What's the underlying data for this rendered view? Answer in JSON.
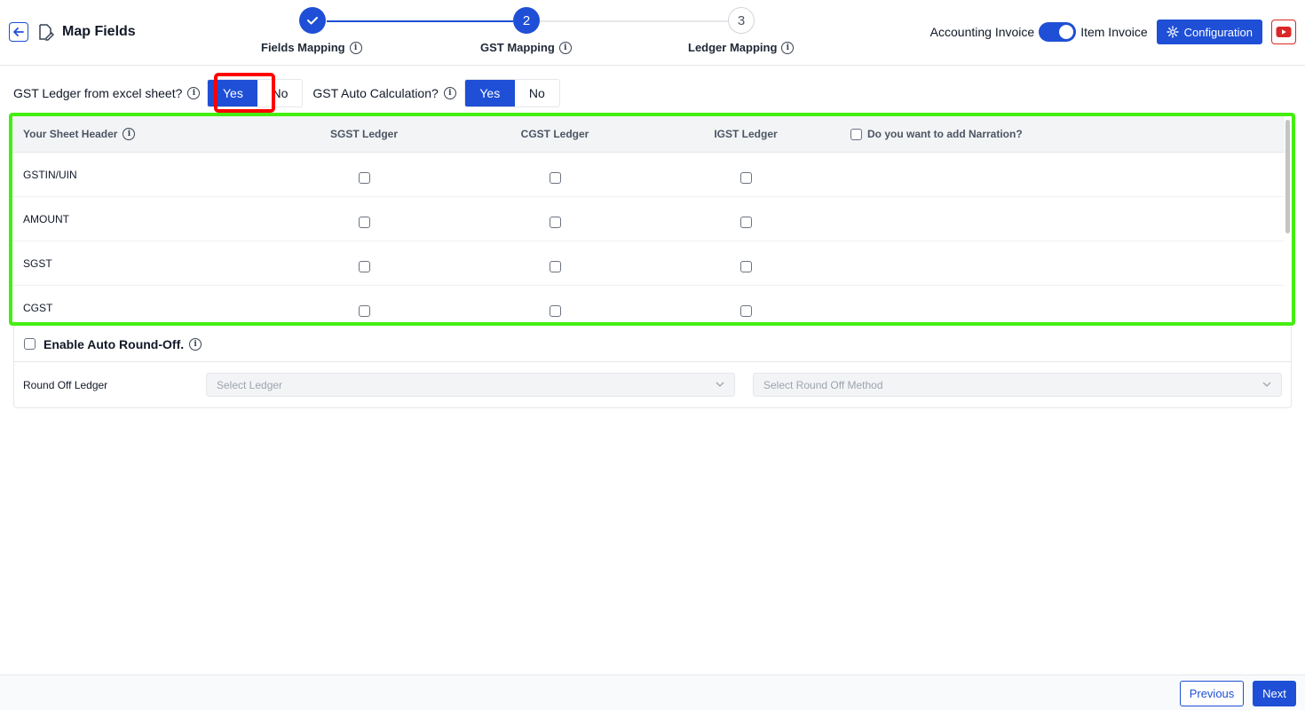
{
  "header": {
    "title": "Map Fields",
    "steps": [
      {
        "number": "",
        "label": "Fields Mapping",
        "state": "done"
      },
      {
        "number": "2",
        "label": "GST Mapping",
        "state": "active"
      },
      {
        "number": "3",
        "label": "Ledger Mapping",
        "state": "pending"
      }
    ],
    "accounting_label": "Accounting Invoice",
    "item_label": "Item Invoice",
    "config_label": "Configuration",
    "icons": [
      "back-arrow-icon",
      "edit-document-icon",
      "check-icon",
      "info-icon",
      "gear-icon",
      "youtube-icon"
    ]
  },
  "questions": {
    "gst_ledger_label": "GST Ledger from excel sheet?",
    "gst_ledger_yes": "Yes",
    "gst_ledger_no": "No",
    "gst_auto_label": "GST Auto Calculation?",
    "gst_auto_yes": "Yes",
    "gst_auto_no": "No"
  },
  "table": {
    "headers": {
      "sheet_header": "Your Sheet Header",
      "sgst": "SGST Ledger",
      "cgst": "CGST Ledger",
      "igst": "IGST Ledger",
      "narration": "Do you want to add Narration?"
    },
    "rows": [
      "GSTIN/UIN",
      "AMOUNT",
      "SGST",
      "CGST"
    ]
  },
  "round_off": {
    "enable_label": "Enable Auto Round-Off.",
    "ledger_label": "Round Off Ledger",
    "select_ledger_placeholder": "Select Ledger",
    "select_method_placeholder": "Select Round Off Method"
  },
  "footer": {
    "previous_label": "Previous",
    "next_label": "Next"
  },
  "colors": {
    "primary": "#1e4fd6",
    "highlight_red": "#ff0000",
    "highlight_green": "#44ee11"
  }
}
